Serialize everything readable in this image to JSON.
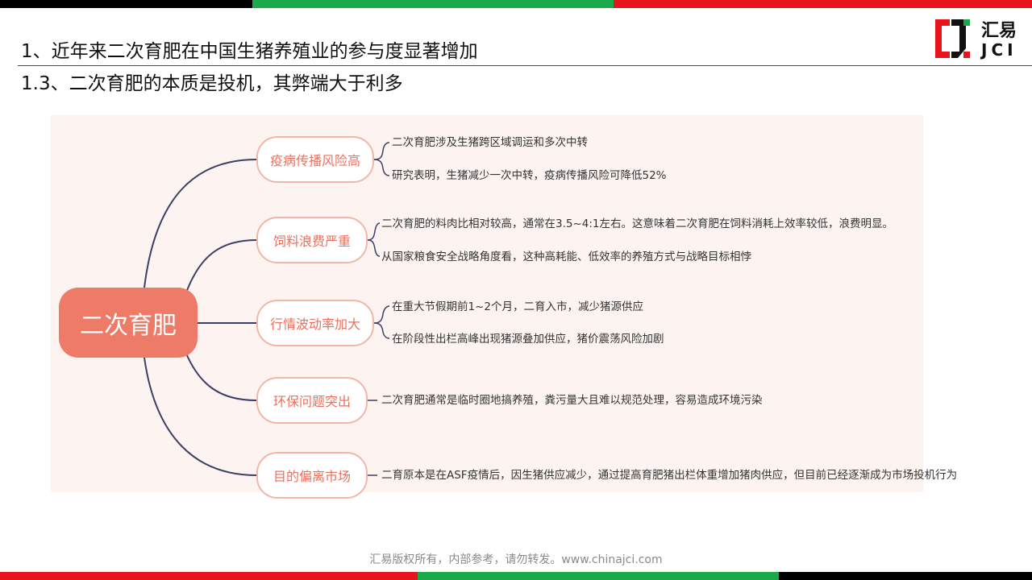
{
  "header": {
    "title_line1": "1、近年来二次育肥在中国生猪养殖业的参与度显著增加",
    "title_line2": "1.3、二次育肥的本质是投机，其弊端大于利多"
  },
  "logo": {
    "name_cn": "汇易",
    "name_en": "JCI",
    "accent_colors": [
      "#e8141c",
      "#1aaa4a",
      "#000000"
    ]
  },
  "mindmap": {
    "root": "二次育肥",
    "branches": [
      {
        "label": "疫病传播风险高",
        "items": [
          "二次育肥涉及生猪跨区域调运和多次中转",
          "研究表明，生猪减少一次中转，疫病传播风险可降低52%"
        ]
      },
      {
        "label": "饲料浪费严重",
        "items": [
          "二次育肥的料肉比相对较高，通常在3.5~4:1左右。这意味着二次育肥在饲料消耗上效率较低，浪费明显。",
          "从国家粮食安全战略角度看，这种高耗能、低效率的养殖方式与战略目标相悖"
        ]
      },
      {
        "label": "行情波动率加大",
        "items": [
          "在重大节假期前1~2个月，二育入市，减少猪源供应",
          "在阶段性出栏高峰出现猪源叠加供应，猪价震荡风险加剧"
        ]
      },
      {
        "label": "环保问题突出",
        "items": [
          "二次育肥通常是临时圈地搞养殖，粪污量大且难以规范处理，容易造成环境污染"
        ]
      },
      {
        "label": "目的偏离市场",
        "items": [
          "二育原本是在ASF疫情后，因生猪供应减少，通过提高育肥猪出栏体重增加猪肉供应，但目前已经逐渐成为市场投机行为"
        ]
      }
    ]
  },
  "footer": {
    "text": "汇易版权所有，内部参考，请勿转发。www.chinajci.com"
  }
}
